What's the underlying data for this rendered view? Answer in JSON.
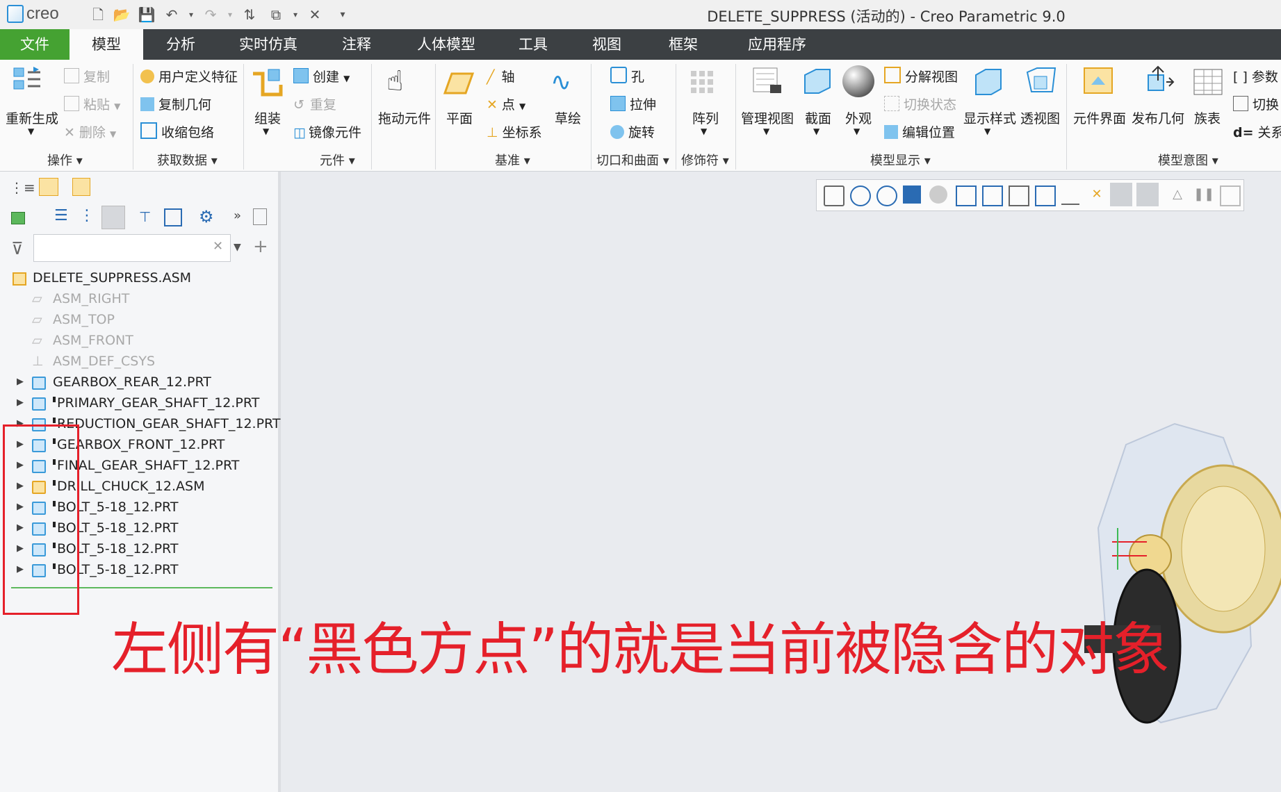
{
  "app": {
    "logo": "creo",
    "window_title": "DELETE_SUPPRESS (活动的) - Creo Parametric 9.0"
  },
  "tabs": [
    "文件",
    "模型",
    "分析",
    "实时仿真",
    "注释",
    "人体模型",
    "工具",
    "视图",
    "框架",
    "应用程序"
  ],
  "ribbon": {
    "regenerate": "重新生成",
    "copy": "复制",
    "paste": "粘贴",
    "delete": "删除",
    "udf": "用户定义特征",
    "copy_geom": "复制几何",
    "shrinkwrap": "收缩包络",
    "assemble": "组装",
    "create": "创建",
    "repeat": "重复",
    "mirror": "镜像元件",
    "drag": "拖动元件",
    "plane": "平面",
    "axis": "轴",
    "point": "点",
    "csys": "坐标系",
    "sketch": "草绘",
    "hole": "孔",
    "extrude": "拉伸",
    "revolve": "旋转",
    "pattern": "阵列",
    "manage_views": "管理视图",
    "section": "截面",
    "appearance": "外观",
    "explode": "分解视图",
    "toggle_status": "切换状态",
    "edit_position": "编辑位置",
    "display_style": "显示样式",
    "perspective": "透视图",
    "comp_interface": "元件界面",
    "publish_geom": "发布几何",
    "family_table": "族表",
    "params": "参数",
    "switch": "切换",
    "relations": "关系",
    "groups": {
      "operations": "操作",
      "get_data": "获取数据",
      "component": "元件",
      "datum": "基准",
      "cut_surface": "切口和曲面",
      "modifier": "修饰符",
      "model_display": "模型显示",
      "model_intent": "模型意图"
    }
  },
  "tree": {
    "root": "DELETE_SUPPRESS.ASM",
    "datums": [
      "ASM_RIGHT",
      "ASM_TOP",
      "ASM_FRONT",
      "ASM_DEF_CSYS"
    ],
    "items": [
      {
        "name": "GEARBOX_REAR_12.PRT",
        "suppressed": false
      },
      {
        "name": "PRIMARY_GEAR_SHAFT_12.PRT",
        "suppressed": true
      },
      {
        "name": "REDUCTION_GEAR_SHAFT_12.PRT",
        "suppressed": true
      },
      {
        "name": "GEARBOX_FRONT_12.PRT",
        "suppressed": true
      },
      {
        "name": "FINAL_GEAR_SHAFT_12.PRT",
        "suppressed": true
      },
      {
        "name": "DRILL_CHUCK_12.ASM",
        "suppressed": true
      },
      {
        "name": "BOLT_5-18_12.PRT",
        "suppressed": true
      },
      {
        "name": "BOLT_5-18_12.PRT",
        "suppressed": true
      },
      {
        "name": "BOLT_5-18_12.PRT",
        "suppressed": true
      },
      {
        "name": "BOLT_5-18_12.PRT",
        "suppressed": true
      }
    ]
  },
  "annotation": "左侧有“黑色方点”的就是当前被隐含的对象",
  "colors": {
    "accent_green": "#45a232",
    "annotation_red": "#e5202a",
    "tabbar": "#3c4043"
  }
}
